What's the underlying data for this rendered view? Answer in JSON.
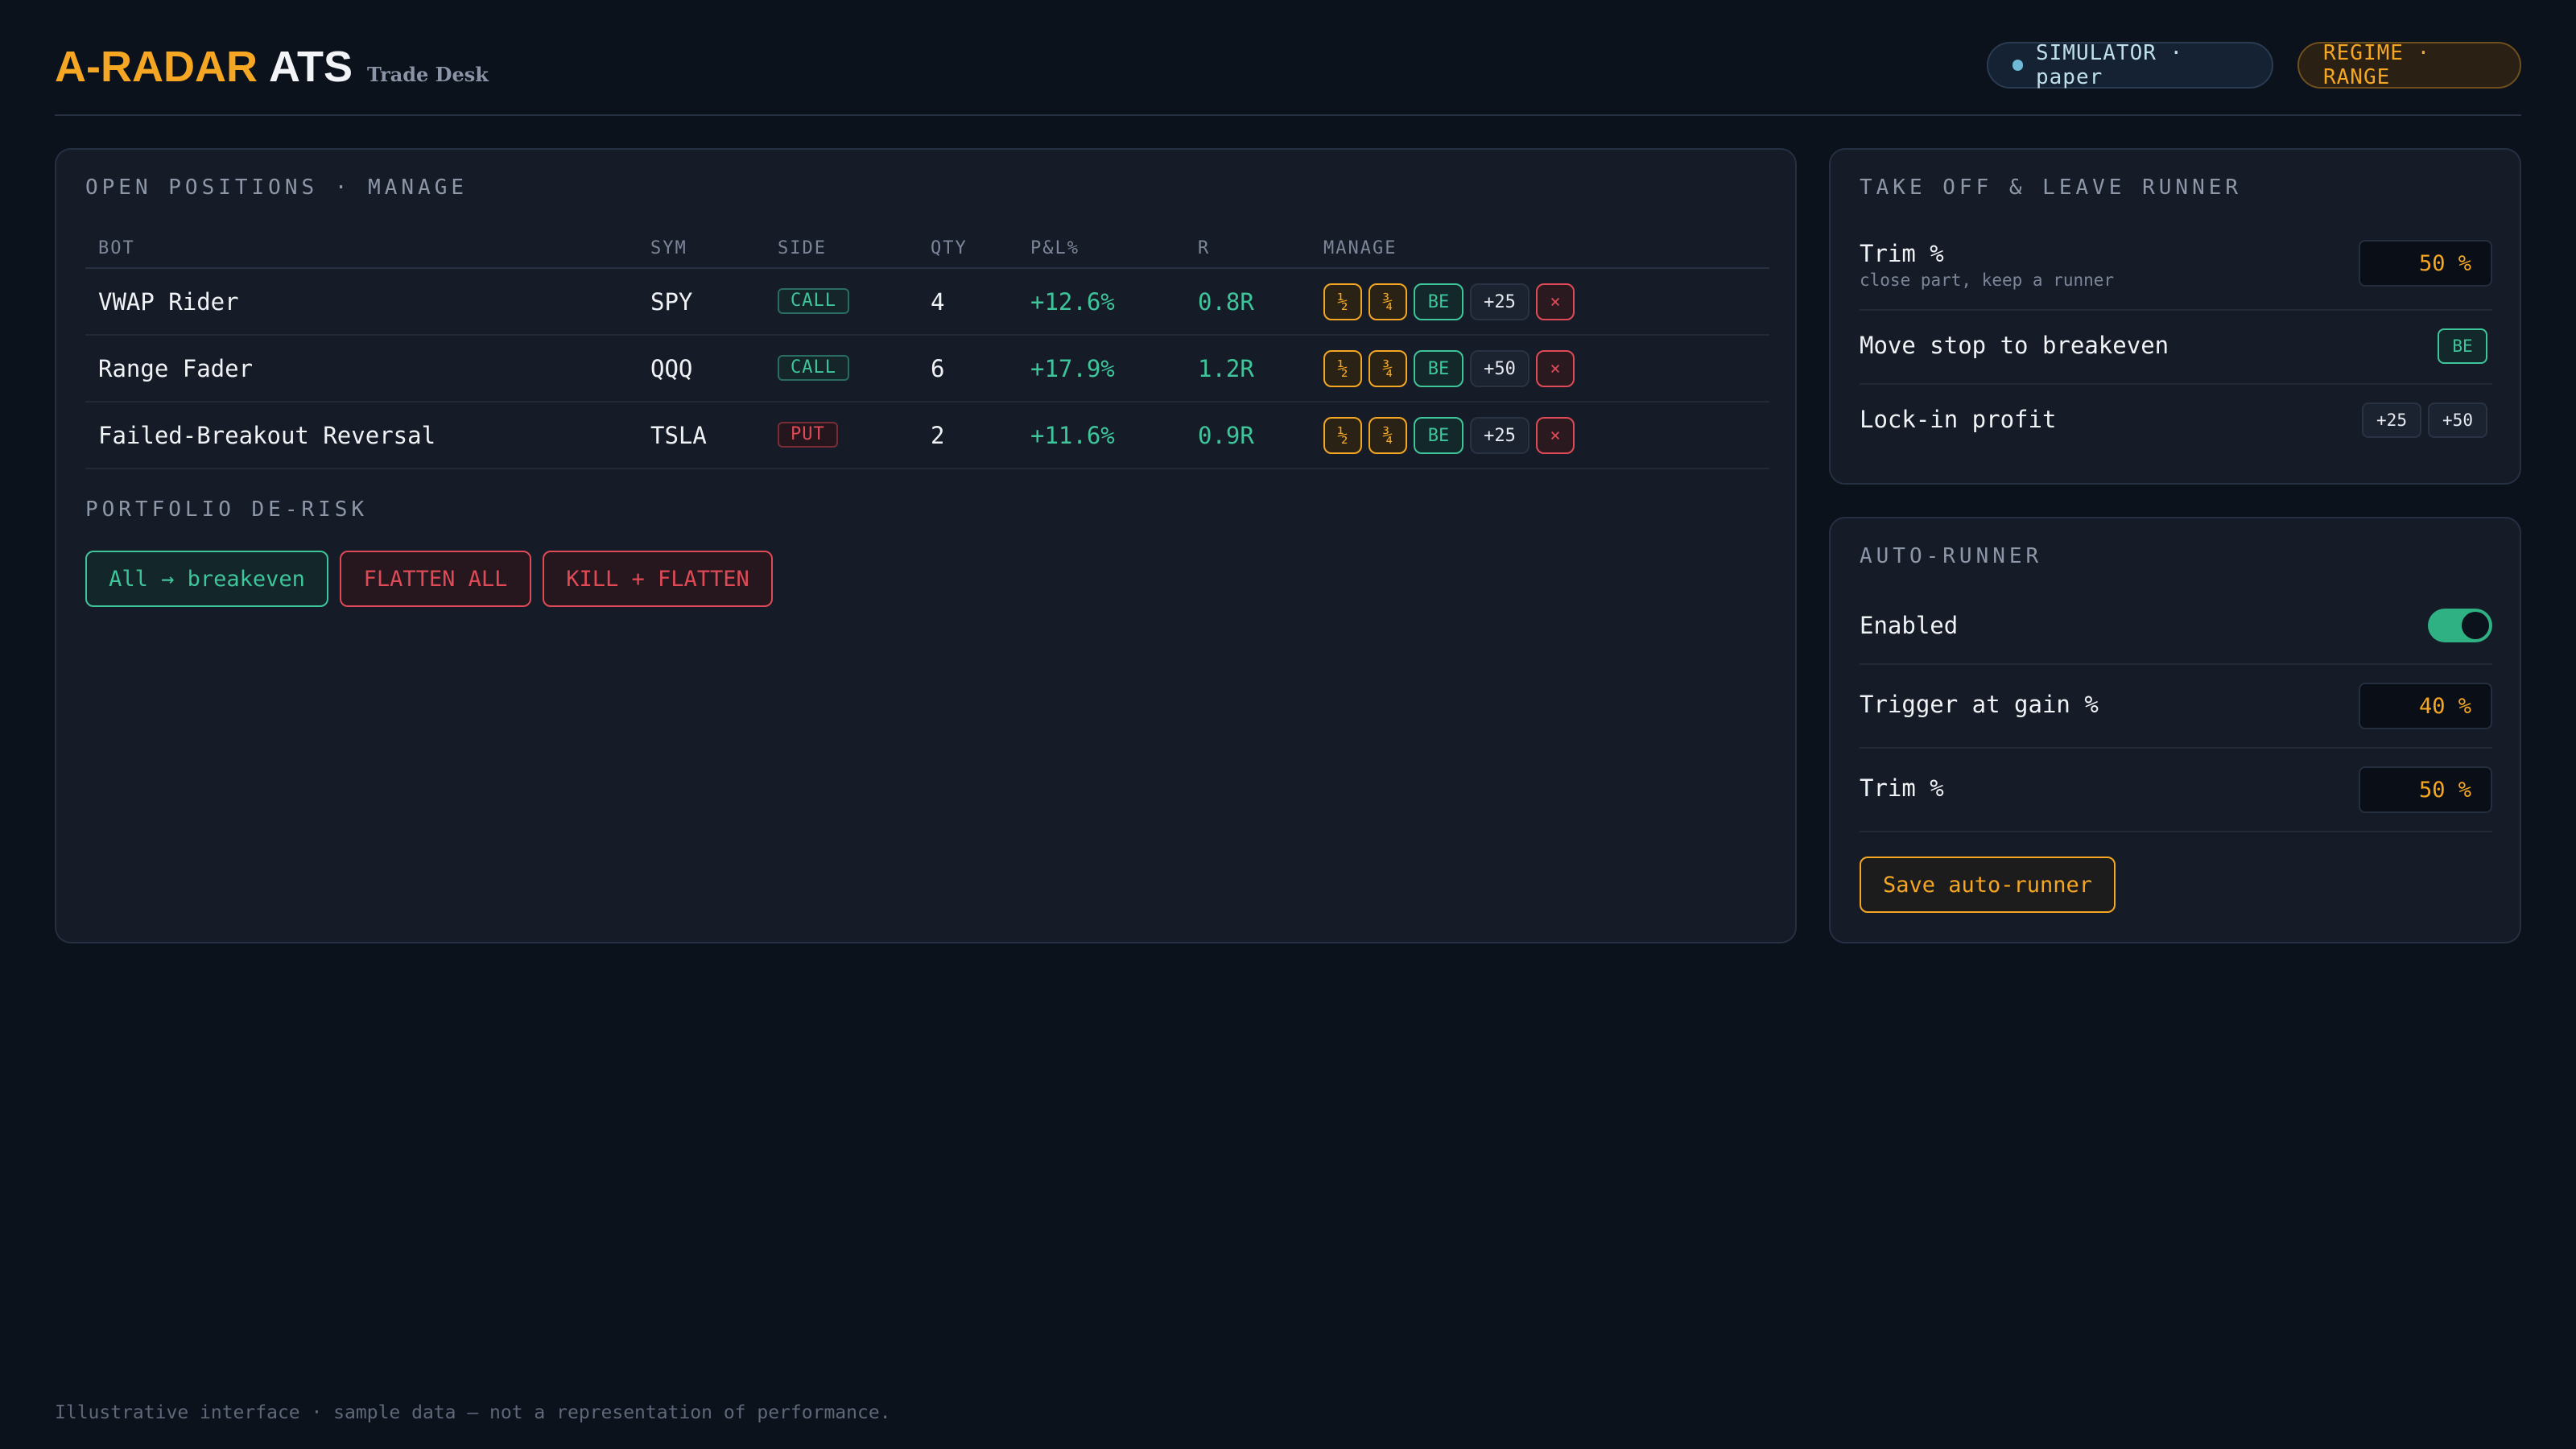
{
  "header": {
    "brand_accent": "A-RADAR",
    "brand_main": "ATS",
    "brand_sub": "Trade Desk",
    "simulator_label": "SIMULATOR · paper",
    "regime_label": "REGIME · RANGE"
  },
  "positions": {
    "title": "OPEN POSITIONS · MANAGE",
    "columns": [
      "BOT",
      "SYM",
      "SIDE",
      "QTY",
      "P&L%",
      "R",
      "MANAGE"
    ],
    "rows": [
      {
        "bot": "VWAP Rider",
        "sym": "SPY",
        "side": "CALL",
        "qty": "4",
        "pnl": "+12.6%",
        "r": "0.8R",
        "lock": "+25"
      },
      {
        "bot": "Range Fader",
        "sym": "QQQ",
        "side": "CALL",
        "qty": "6",
        "pnl": "+17.9%",
        "r": "1.2R",
        "lock": "+50"
      },
      {
        "bot": "Failed-Breakout Reversal",
        "sym": "TSLA",
        "side": "PUT",
        "qty": "2",
        "pnl": "+11.6%",
        "r": "0.9R",
        "lock": "+25"
      }
    ],
    "manage": {
      "half": "½",
      "three_quarter": "¾",
      "be": "BE",
      "close": "×"
    }
  },
  "derisk": {
    "title": "PORTFOLIO DE-RISK",
    "all_be": "All → breakeven",
    "flatten": "FLATTEN ALL",
    "kill": "KILL + FLATTEN"
  },
  "take_off": {
    "title": "TAKE OFF & LEAVE RUNNER",
    "trim_label": "Trim %",
    "trim_sub": "close part, keep a runner",
    "trim_value": "50 %",
    "breakeven_label": "Move stop to breakeven",
    "breakeven_btn": "BE",
    "lock_label": "Lock-in profit",
    "lock_a": "+25",
    "lock_b": "+50"
  },
  "auto_runner": {
    "title": "AUTO-RUNNER",
    "enabled_label": "Enabled",
    "enabled": true,
    "trigger_label": "Trigger at gain %",
    "trigger_value": "40 %",
    "trim_label": "Trim %",
    "trim_value": "50 %",
    "save_label": "Save auto-runner"
  },
  "footer": "Illustrative interface · sample data — not a representation of performance.",
  "colors": {
    "accent": "#f5a623",
    "positive": "#3ec59a",
    "danger": "#e04a57",
    "background": "#0c121c"
  }
}
